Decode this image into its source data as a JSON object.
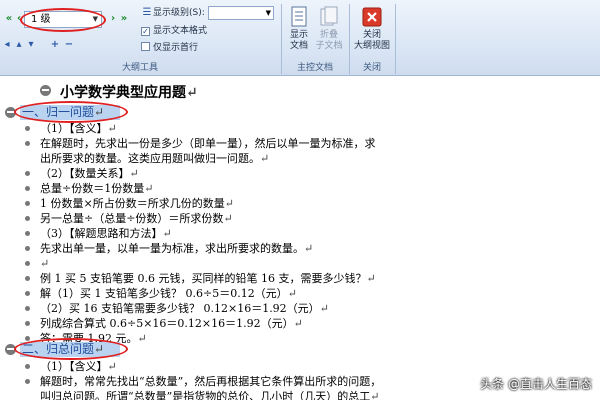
{
  "ribbon": {
    "level_select": {
      "value": "1 级"
    },
    "show_level_label": "显示级别(S):",
    "show_text_format_label": "显示文本格式",
    "show_text_format_checked": true,
    "show_first_line_label": "仅显示首行",
    "show_first_line_checked": false,
    "outline_tools_label": "大纲工具",
    "show_document": {
      "line1": "显示",
      "line2": "文档"
    },
    "collapse_subdoc": {
      "line1": "折叠",
      "line2": "子文档"
    },
    "master_doc_label": "主控文档",
    "close_outline": {
      "line1": "关闭",
      "line2": "大纲视图"
    },
    "close_label": "关闭"
  },
  "document": {
    "title": "小学数学典型应用题",
    "sections": [
      {
        "heading": "一、归一问题",
        "lines": [
          "（1）【含义】",
          "在解题时，先求出一份是多少（即单一量），然后以单一量为标准，求",
          "出所要求的数量。这类应用题叫做归一问题。",
          "（2）【数量关系】",
          "总量÷份数＝1份数量",
          "1 份数量×所占份数＝所求几份的数量",
          "另一总量÷（总量÷份数）＝所求份数",
          "（3）【解题思路和方法】",
          "先求出单一量，以单一量为标准，求出所要求的数量。",
          "",
          "例 1 买 5 支铅笔要 0.6 元钱，买同样的铅笔 16 支，需要多少钱？",
          "解（1）买 1 支铅笔多少钱？ 0.6÷5＝0.12（元）",
          "（2）买 16 支铅笔需要多少钱？ 0.12×16＝1.92（元）",
          "列成综合算式 0.6÷5×16＝0.12×16＝1.92（元）",
          "答：需要 1.92 元。"
        ]
      },
      {
        "heading": "二、归总问题",
        "lines": [
          "（1）【含义】",
          "解题时，常常先找出“总数量”，然后再根据其它条件算出所求的问题，",
          "叫归总问题。所谓“总数量”是指货物的总价、几小时（几天）的总工"
        ]
      }
    ],
    "para_mark": "↵"
  },
  "watermark": "头条 @直击人生百态"
}
